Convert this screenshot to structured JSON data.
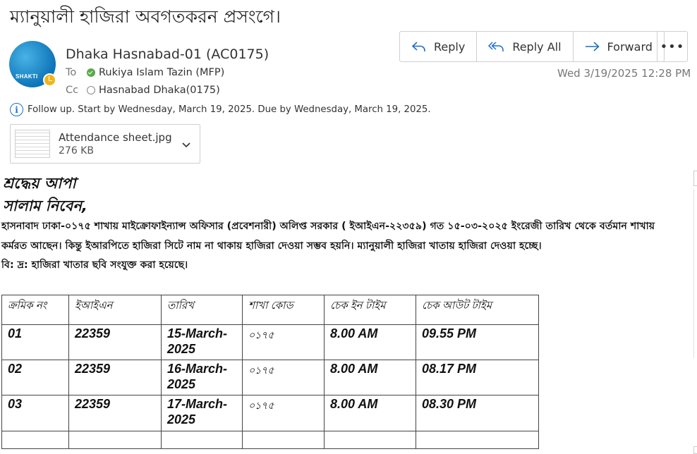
{
  "email": {
    "subject": "ম্যানুয়ালী হাজিরা অবগতকরন প্রসংগে।",
    "avatar_text": "SHAKTI",
    "sender": "Dhaka Hasnabad-01 (AC0175)",
    "to_label": "To",
    "to_name": "Rukiya Islam Tazin (MFP)",
    "cc_label": "Cc",
    "cc_name": "Hasnabad Dhaka(0175)",
    "date": "Wed 3/19/2025 12:28 PM",
    "followup": "Follow up.  Start by Wednesday, March 19, 2025.  Due by Wednesday, March 19, 2025."
  },
  "actions": {
    "reply": "Reply",
    "reply_all": "Reply All",
    "forward": "Forward",
    "more": "•••"
  },
  "attachment": {
    "name": "Attendance sheet.jpg",
    "size": "276 KB"
  },
  "body": {
    "greeting1": "শ্রদ্ধেয় আপা",
    "greeting2": "সালাম নিবেন,",
    "line1": "হাসনাবাদ ঢাকা-০১৭৫ শাখায় মাইক্রোফাইন্যান্স অফিসার (প্রবেশনারী) অলিপ্ত সরকার ( ইআইএন-২২৩৫৯) গত ১৫-০৩-২০২৫ ইংরেজী তারিখ থেকে বর্তমান শাখায়",
    "line2": "কর্মরত আছেন। কিন্তু ইআরপিতে হাজিরা সিটে নাম না থাকায় হাজিরা দেওয়া সম্ভব হয়নি। ম্যানুয়ালী হাজিরা খাতায় হাজিরা দেওয়া হচ্ছে।",
    "line3": "বি: দ্র: হাজিরা খাতার ছবি সংযুক্ত করা হয়েছে।"
  },
  "table": {
    "headers": [
      "ক্রমিক নং",
      "ইআইএন",
      "তারিখ",
      "শাখা কোড",
      "চেক ইন টাইম",
      "চেক আউট টাইম"
    ],
    "rows": [
      [
        "01",
        "22359",
        "15-March-2025",
        "০১৭৫",
        "8.00 AM",
        "09.55 PM"
      ],
      [
        "02",
        "22359",
        "16-March-2025",
        "০১৭৫",
        "8.00 AM",
        "08.17 PM"
      ],
      [
        "03",
        "22359",
        "17-March-2025",
        "০১৭৫",
        "8.00 AM",
        "08.30 PM"
      ]
    ]
  },
  "colors": {
    "accent": "#1a6fc9",
    "presence_green": "#5aa84a",
    "avatar_blue": "#0d74b8",
    "status_yellow": "#f2b31b"
  }
}
